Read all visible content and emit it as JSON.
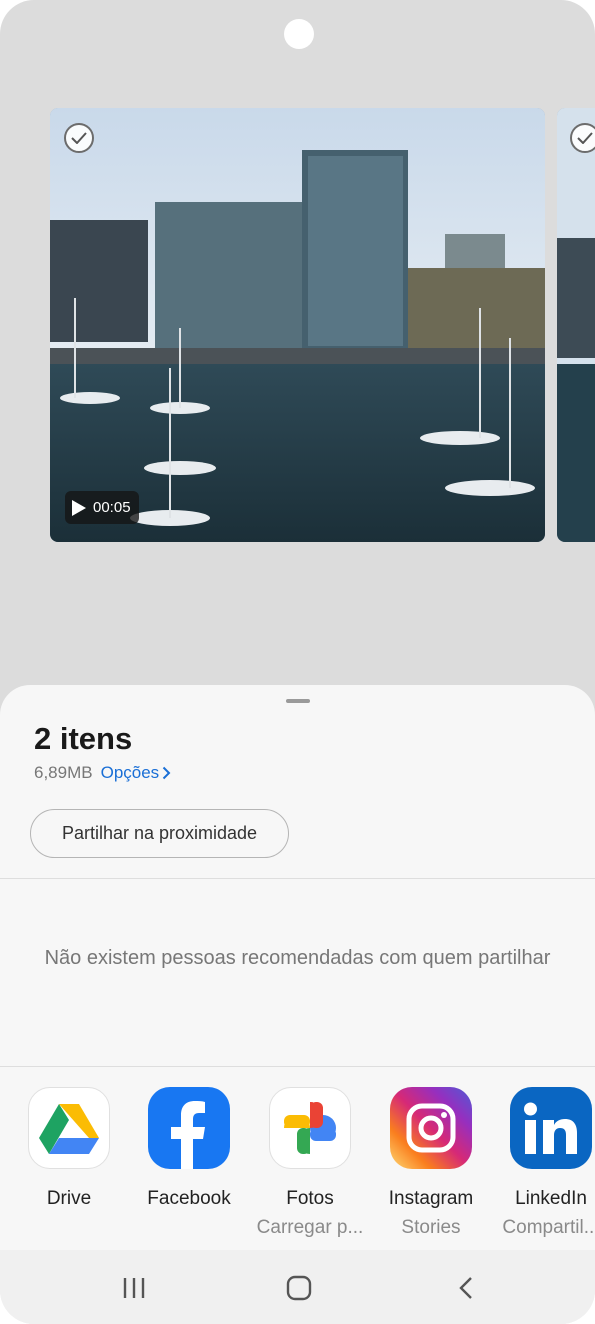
{
  "preview": {
    "video_duration": "00:05"
  },
  "sheet": {
    "title": "2 itens",
    "size": "6,89MB",
    "options_label": "Opções",
    "nearby_share_label": "Partilhar na proximidade",
    "empty_people_message": "Não existem pessoas recomendadas com quem partilhar"
  },
  "apps": [
    {
      "name": "Drive",
      "sub": "",
      "icon": "google-drive-icon"
    },
    {
      "name": "Facebook",
      "sub": "",
      "icon": "facebook-icon"
    },
    {
      "name": "Fotos",
      "sub": "Carregar p...",
      "icon": "google-photos-icon"
    },
    {
      "name": "Instagram",
      "sub": "Stories",
      "icon": "instagram-icon"
    },
    {
      "name": "LinkedIn",
      "sub": "Compartil...",
      "icon": "linkedin-icon"
    }
  ],
  "navbar": {
    "buttons": [
      "recent-apps-icon",
      "home-icon",
      "back-icon"
    ]
  },
  "colors": {
    "accent": "#1a6fd6",
    "facebook": "#1877f2",
    "linkedin": "#0a66c2"
  }
}
